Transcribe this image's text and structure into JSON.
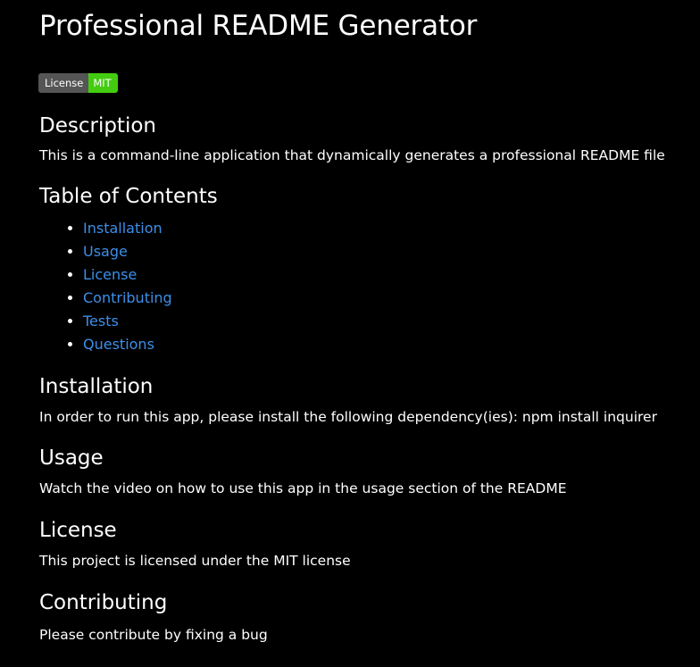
{
  "title": "Professional README Generator",
  "badge": {
    "label": "License",
    "value": "MIT",
    "label_color": "#555555",
    "value_color": "#44cc11"
  },
  "sections": {
    "description": {
      "heading": "Description",
      "text": "This is a command-line application that dynamically generates a professional README file"
    },
    "toc": {
      "heading": "Table of Contents",
      "items": [
        "Installation",
        "Usage",
        "License",
        "Contributing",
        "Tests",
        "Questions"
      ]
    },
    "installation": {
      "heading": "Installation",
      "text": "In order to run this app, please install the following dependency(ies): npm install inquirer"
    },
    "usage": {
      "heading": "Usage",
      "text": "Watch the video on how to use this app in the usage section of the README"
    },
    "license": {
      "heading": "License",
      "text": "This project is licensed under the MIT license"
    },
    "contributing": {
      "heading": "Contributing",
      "text": "Please contribute by fixing a bug"
    }
  },
  "colors": {
    "background": "#000000",
    "text": "#ffffff",
    "link": "#3d8fe8"
  }
}
